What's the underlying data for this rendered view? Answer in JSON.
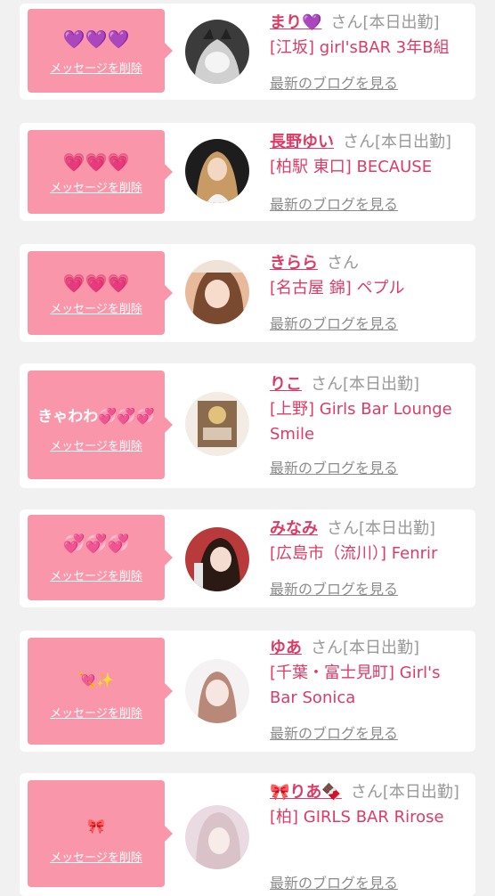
{
  "common": {
    "delete_label": "メッセージを削除",
    "blog_label": "最新のブログを見る",
    "san": "さん",
    "working": "[本日出勤]"
  },
  "items": [
    {
      "message": "💜💜💜",
      "name": "まり",
      "name_emoji": "💜",
      "working": true,
      "shop": "[江坂] girl'sBAR 3年B組",
      "avatar": "avatar-mari"
    },
    {
      "message": "💗💗💗",
      "name": "長野ゆい",
      "working": true,
      "shop": "[柏駅 東口] BECAUSE",
      "avatar": "avatar-nagano-yui"
    },
    {
      "message": "💗💗💗",
      "name": "きらら",
      "working": false,
      "shop": "[名古屋 錦] ペプル",
      "avatar": "avatar-kirara"
    },
    {
      "message": "きゃわわ💞💞💞",
      "name": "りこ",
      "working": true,
      "shop": "[上野] Girls Bar Lounge Smile",
      "avatar": "avatar-riko"
    },
    {
      "message": "💞💞💞",
      "name": "みなみ",
      "working": true,
      "shop": "[広島市（流川）] Fenrir",
      "avatar": "avatar-minami"
    },
    {
      "message": "💘✨",
      "name": "ゆあ",
      "working": true,
      "shop": "[千葉・富士見町] Girl's Bar Sonica",
      "avatar": "avatar-yua"
    },
    {
      "message": "🎀",
      "name": "りあ",
      "name_prefix": "🎀",
      "name_emoji": "🍫",
      "working": true,
      "shop": "[柏] GIRLS BAR Rirose",
      "avatar": "avatar-ria"
    }
  ],
  "colors": {
    "background": "#f1f1f1",
    "card": "#ffffff",
    "bubble": "#f996a9",
    "name": "#dd3b66",
    "muted": "#999999"
  }
}
